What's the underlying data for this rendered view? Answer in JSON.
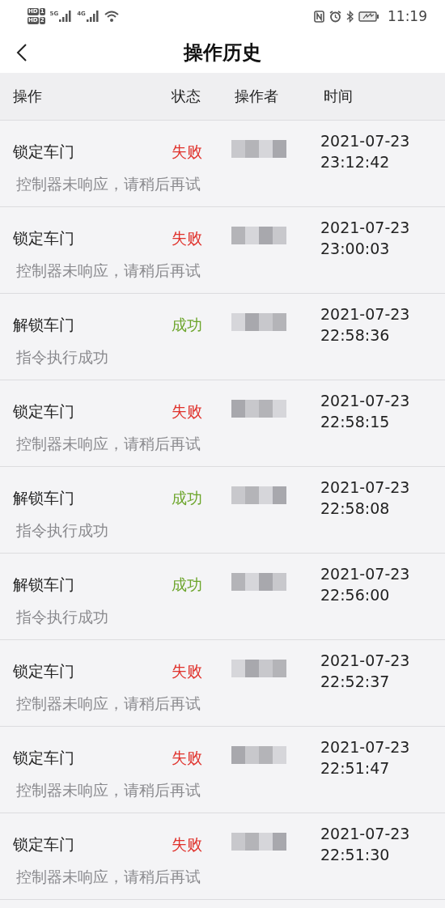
{
  "status_bar": {
    "sims": [
      {
        "badge": "HD",
        "slot": "1"
      },
      {
        "badge": "HD",
        "slot": "2"
      }
    ],
    "networks": [
      "5G",
      "4G"
    ],
    "time": "11:19"
  },
  "header": {
    "title": "操作历史"
  },
  "table": {
    "columns": [
      "操作",
      "状态",
      "操作者",
      "时间"
    ],
    "rows": [
      {
        "action": "锁定车门",
        "status": "失败",
        "color": "#e0322c",
        "message": "控制器未响应，请稍后再试",
        "date": "2021-07-23",
        "time": "23:12:42"
      },
      {
        "action": "锁定车门",
        "status": "失败",
        "color": "#e0322c",
        "message": "控制器未响应，请稍后再试",
        "date": "2021-07-23",
        "time": "23:00:03"
      },
      {
        "action": "解锁车门",
        "status": "成功",
        "color": "#6ca52b",
        "message": "指令执行成功",
        "date": "2021-07-23",
        "time": "22:58:36"
      },
      {
        "action": "锁定车门",
        "status": "失败",
        "color": "#e0322c",
        "message": "控制器未响应，请稍后再试",
        "date": "2021-07-23",
        "time": "22:58:15"
      },
      {
        "action": "解锁车门",
        "status": "成功",
        "color": "#6ca52b",
        "message": "指令执行成功",
        "date": "2021-07-23",
        "time": "22:58:08"
      },
      {
        "action": "解锁车门",
        "status": "成功",
        "color": "#6ca52b",
        "message": "指令执行成功",
        "date": "2021-07-23",
        "time": "22:56:00"
      },
      {
        "action": "锁定车门",
        "status": "失败",
        "color": "#e0322c",
        "message": "控制器未响应，请稍后再试",
        "date": "2021-07-23",
        "time": "22:52:37"
      },
      {
        "action": "锁定车门",
        "status": "失败",
        "color": "#e0322c",
        "message": "控制器未响应，请稍后再试",
        "date": "2021-07-23",
        "time": "22:51:47"
      },
      {
        "action": "锁定车门",
        "status": "失败",
        "color": "#e0322c",
        "message": "控制器未响应，请稍后再试",
        "date": "2021-07-23",
        "time": "22:51:30"
      }
    ]
  }
}
